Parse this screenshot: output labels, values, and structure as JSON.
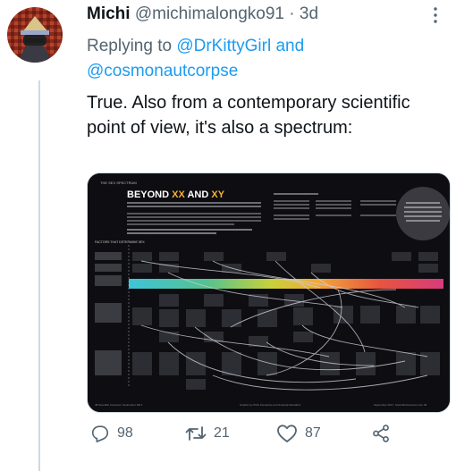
{
  "tweet": {
    "author_name": "Michi",
    "author_handle": "@michimalongko91",
    "separator": "·",
    "time": "3d",
    "replying_prefix": "Replying to",
    "mention_1": "@DrKittyGirl",
    "conjunction": "and",
    "mention_2": "@cosmonautcorpse",
    "text": "True. Also from a contemporary scientific point of view, it's also a spectrum:"
  },
  "media": {
    "header_small": "THE SEX SPECTRUM",
    "title_prefix": "BEYOND ",
    "title_xx": "XX",
    "title_and": " AND ",
    "title_xy": "XY",
    "row_heading": "FACTORS THAT DETERMINE SEX",
    "footer_left": "48  Scientific American, September 2017",
    "footer_center": "Graphic by Pitch Interactive and Amanda Montañez",
    "footer_right": "September 2017, ScientificAmerican.com  49"
  },
  "actions": {
    "replies": "98",
    "retweets": "21",
    "likes": "87"
  },
  "colors": {
    "link": "#1d9bf0",
    "muted": "#536471",
    "text": "#0f1419"
  }
}
